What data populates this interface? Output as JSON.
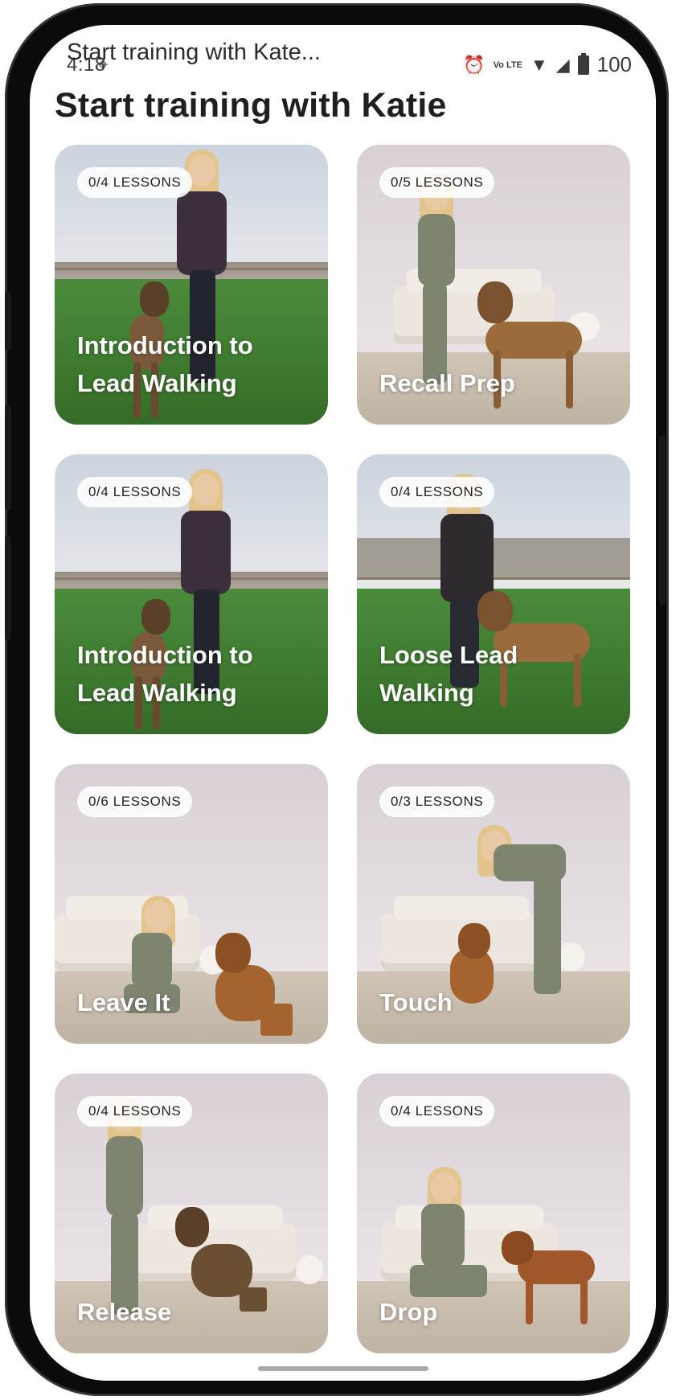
{
  "status_bar": {
    "time": "4:18",
    "notification_title": "Start training with Kate...",
    "battery_text": "100",
    "icons": [
      "location-pin-icon",
      "alarm-icon",
      "volte-icon",
      "wifi-icon",
      "signal-icon",
      "battery-icon"
    ],
    "lte_line1": "Vo",
    "lte_line2": "LTE"
  },
  "page": {
    "title": "Start training with Katie"
  },
  "courses": [
    {
      "title": "Introduction to Lead Walking",
      "lessons": "0/4 LESSONS",
      "scene": "outdoor"
    },
    {
      "title": "Recall Prep",
      "lessons": "0/5 LESSONS",
      "scene": "indoor"
    },
    {
      "title": "Introduction to Lead Walking",
      "lessons": "0/4 LESSONS",
      "scene": "outdoor"
    },
    {
      "title": "Loose Lead Walking",
      "lessons": "0/4 LESSONS",
      "scene": "outdoor-trees"
    },
    {
      "title": "Leave It",
      "lessons": "0/6 LESSONS",
      "scene": "indoor"
    },
    {
      "title": "Touch",
      "lessons": "0/3 LESSONS",
      "scene": "indoor"
    },
    {
      "title": "Release",
      "lessons": "0/4 LESSONS",
      "scene": "indoor"
    },
    {
      "title": "Drop",
      "lessons": "0/4 LESSONS",
      "scene": "indoor"
    }
  ],
  "colors": {
    "title_text": "#1f1f1f",
    "card_text": "#ffffff",
    "badge_bg": "#ffffff",
    "grass": "#3d7a2f",
    "wall": "#e2dbe0"
  }
}
